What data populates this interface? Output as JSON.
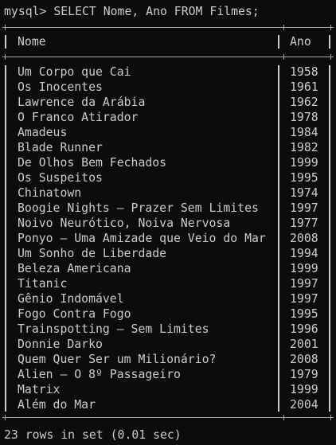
{
  "terminal": {
    "prompt": "mysql> ",
    "command": "SELECT Nome, Ano FROM Filmes;",
    "footer": "23 rows in set (0.01 sec)"
  },
  "table": {
    "columns": [
      "Nome",
      "Ano"
    ],
    "rows": [
      {
        "nome": "Um Corpo que Cai",
        "ano": "1958"
      },
      {
        "nome": "Os Inocentes",
        "ano": "1961"
      },
      {
        "nome": "Lawrence da Arábia",
        "ano": "1962"
      },
      {
        "nome": "O Franco Atirador",
        "ano": "1978"
      },
      {
        "nome": "Amadeus",
        "ano": "1984"
      },
      {
        "nome": "Blade Runner",
        "ano": "1982"
      },
      {
        "nome": "De Olhos Bem Fechados",
        "ano": "1999"
      },
      {
        "nome": "Os Suspeitos",
        "ano": "1995"
      },
      {
        "nome": "Chinatown",
        "ano": "1974"
      },
      {
        "nome": "Boogie Nights – Prazer Sem Limites",
        "ano": "1997"
      },
      {
        "nome": "Noivo Neurótico, Noiva Nervosa",
        "ano": "1977"
      },
      {
        "nome": "Ponyo – Uma Amizade que Veio do Mar",
        "ano": "2008"
      },
      {
        "nome": "Um Sonho de Liberdade",
        "ano": "1994"
      },
      {
        "nome": "Beleza Americana",
        "ano": "1999"
      },
      {
        "nome": "Titanic",
        "ano": "1997"
      },
      {
        "nome": "Gênio Indomável",
        "ano": "1997"
      },
      {
        "nome": "Fogo Contra Fogo",
        "ano": "1995"
      },
      {
        "nome": "Trainspotting – Sem Limites",
        "ano": "1996"
      },
      {
        "nome": "Donnie Darko",
        "ano": "2001"
      },
      {
        "nome": "Quem Quer Ser um Milionário?",
        "ano": "2008"
      },
      {
        "nome": "Alien – O 8º Passageiro",
        "ano": "1979"
      },
      {
        "nome": "Matrix",
        "ano": "1999"
      },
      {
        "nome": "Além do Mar",
        "ano": "2004"
      }
    ]
  },
  "colors": {
    "background": "#0c0c0c",
    "text": "#cccccc",
    "border": "#a8a8a8"
  }
}
